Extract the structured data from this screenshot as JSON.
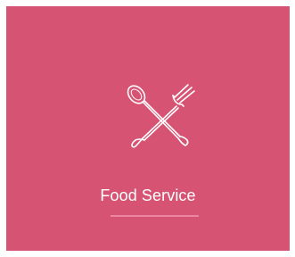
{
  "card": {
    "title": "Food Service",
    "icon": "fork-and-spoon-icon",
    "background_color": "#d65373",
    "accent_color": "#e8879f",
    "text_color": "#ffffff"
  }
}
